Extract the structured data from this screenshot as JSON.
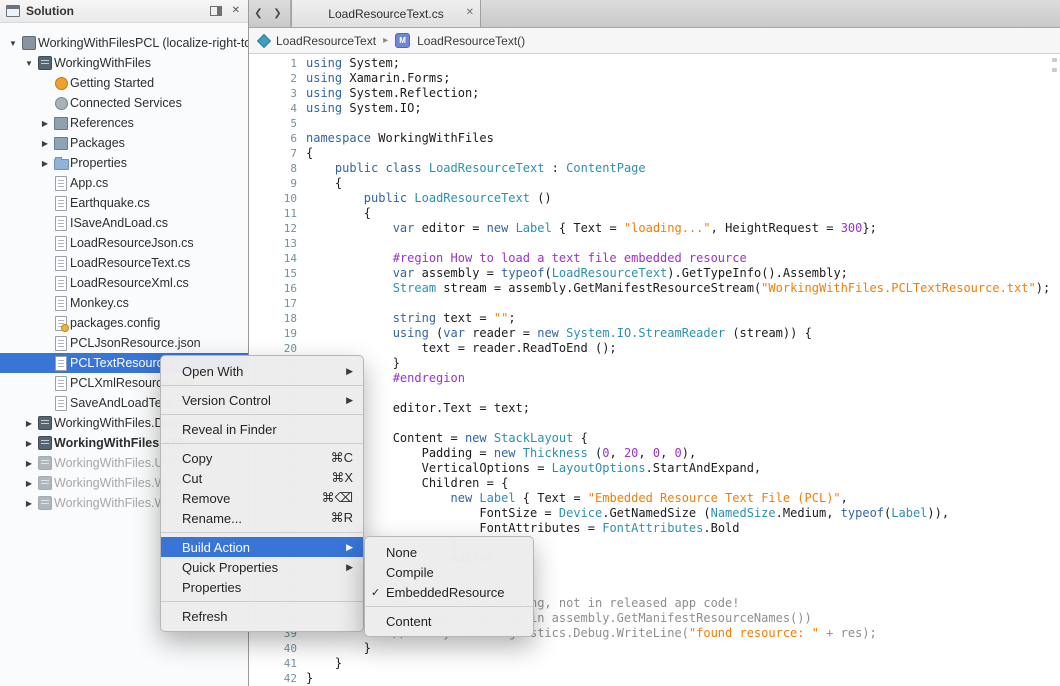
{
  "colors": {
    "selection_blue": "#3875d6",
    "keyword_blue": "#3364a4",
    "type_teal": "#2b91af",
    "string_orange": "#f57d00",
    "number_purple": "#9933cc",
    "comment_gray": "#8e8e8e"
  },
  "sidebar": {
    "title": "Solution",
    "items": [
      {
        "label": "WorkingWithFilesPCL (localize-right-to-lef",
        "level": 0,
        "expander": "open",
        "icon": "solution"
      },
      {
        "label": "WorkingWithFiles",
        "level": 1,
        "expander": "open",
        "icon": "project"
      },
      {
        "label": "Getting Started",
        "level": 2,
        "icon": "getting-started"
      },
      {
        "label": "Connected Services",
        "level": 2,
        "icon": "connected-services"
      },
      {
        "label": "References",
        "level": 2,
        "expander": "closed",
        "icon": "references"
      },
      {
        "label": "Packages",
        "level": 2,
        "expander": "closed",
        "icon": "packages"
      },
      {
        "label": "Properties",
        "level": 2,
        "expander": "closed",
        "icon": "folder"
      },
      {
        "label": "App.cs",
        "level": 2,
        "icon": "doc"
      },
      {
        "label": "Earthquake.cs",
        "level": 2,
        "icon": "doc"
      },
      {
        "label": "ISaveAndLoad.cs",
        "level": 2,
        "icon": "doc"
      },
      {
        "label": "LoadResourceJson.cs",
        "level": 2,
        "icon": "doc"
      },
      {
        "label": "LoadResourceText.cs",
        "level": 2,
        "icon": "doc"
      },
      {
        "label": "LoadResourceXml.cs",
        "level": 2,
        "icon": "doc"
      },
      {
        "label": "Monkey.cs",
        "level": 2,
        "icon": "doc"
      },
      {
        "label": "packages.config",
        "level": 2,
        "icon": "doc-config"
      },
      {
        "label": "PCLJsonResource.json",
        "level": 2,
        "icon": "doc"
      },
      {
        "label": "PCLTextResource.txt",
        "level": 2,
        "icon": "doc",
        "selected": true
      },
      {
        "label": "PCLXmlResource.xml",
        "level": 2,
        "icon": "doc"
      },
      {
        "label": "SaveAndLoadText.cs",
        "level": 2,
        "icon": "doc"
      },
      {
        "label": "WorkingWithFiles.Droid",
        "level": 1,
        "expander": "closed",
        "icon": "project"
      },
      {
        "label": "WorkingWithFiles.iOS",
        "level": 1,
        "expander": "closed",
        "icon": "project",
        "bold": true
      },
      {
        "label": "WorkingWithFiles.UWP",
        "level": 1,
        "expander": "closed",
        "icon": "project",
        "dim": true
      },
      {
        "label": "WorkingWithFiles.WinP",
        "level": 1,
        "expander": "closed",
        "icon": "project",
        "dim": true
      },
      {
        "label": "WorkingWithFiles.WinP",
        "level": 1,
        "expander": "closed",
        "icon": "project",
        "dim": true
      }
    ]
  },
  "tabbar": {
    "back_icon": "❮",
    "forward_icon": "❯",
    "tab_label": "LoadResourceText.cs",
    "close_icon": "✕"
  },
  "breadcrumb": {
    "class_name": "LoadResourceText",
    "chevron": "▸",
    "method_icon_letter": "M",
    "method_name": "LoadResourceText()"
  },
  "editor": {
    "lines": [
      [
        [
          "kw",
          "using"
        ],
        [
          "pl",
          " System;"
        ]
      ],
      [
        [
          "kw",
          "using"
        ],
        [
          "pl",
          " Xamarin.Forms;"
        ]
      ],
      [
        [
          "kw",
          "using"
        ],
        [
          "pl",
          " System.Reflection;"
        ]
      ],
      [
        [
          "kw",
          "using"
        ],
        [
          "pl",
          " System.IO;"
        ]
      ],
      [],
      [
        [
          "kw",
          "namespace"
        ],
        [
          "pl",
          " WorkingWithFiles"
        ]
      ],
      [
        [
          "pl",
          "{"
        ]
      ],
      [
        [
          "pl",
          "    "
        ],
        [
          "kw",
          "public"
        ],
        [
          "pl",
          " "
        ],
        [
          "kw",
          "class"
        ],
        [
          "pl",
          " "
        ],
        [
          "ty",
          "LoadResourceText"
        ],
        [
          "pl",
          " : "
        ],
        [
          "ty",
          "ContentPage"
        ]
      ],
      [
        [
          "pl",
          "    {"
        ]
      ],
      [
        [
          "pl",
          "        "
        ],
        [
          "kw",
          "public"
        ],
        [
          "pl",
          " "
        ],
        [
          "ty",
          "LoadResourceText"
        ],
        [
          "pl",
          " ()"
        ]
      ],
      [
        [
          "pl",
          "        {"
        ]
      ],
      [
        [
          "pl",
          "            "
        ],
        [
          "kw",
          "var"
        ],
        [
          "pl",
          " editor = "
        ],
        [
          "kw",
          "new"
        ],
        [
          "pl",
          " "
        ],
        [
          "ty",
          "Label"
        ],
        [
          "pl",
          " { Text = "
        ],
        [
          "st",
          "\"loading...\""
        ],
        [
          "pl",
          ", HeightRequest = "
        ],
        [
          "nu",
          "300"
        ],
        [
          "pl",
          "};"
        ]
      ],
      [],
      [
        [
          "pp",
          "            #region How to load a text file embedded resource"
        ]
      ],
      [
        [
          "pl",
          "            "
        ],
        [
          "kw",
          "var"
        ],
        [
          "pl",
          " assembly = "
        ],
        [
          "kw",
          "typeof"
        ],
        [
          "pl",
          "("
        ],
        [
          "ty",
          "LoadResourceText"
        ],
        [
          "pl",
          ").GetTypeInfo().Assembly;"
        ]
      ],
      [
        [
          "pl",
          "            "
        ],
        [
          "ty",
          "Stream"
        ],
        [
          "pl",
          " stream = assembly.GetManifestResourceStream("
        ],
        [
          "st",
          "\"WorkingWithFiles.PCLTextResource.txt\""
        ],
        [
          "pl",
          ");"
        ]
      ],
      [],
      [
        [
          "pl",
          "            "
        ],
        [
          "kw",
          "string"
        ],
        [
          "pl",
          " text = "
        ],
        [
          "st",
          "\"\""
        ],
        [
          "pl",
          ";"
        ]
      ],
      [
        [
          "pl",
          "            "
        ],
        [
          "kw",
          "using"
        ],
        [
          "pl",
          " ("
        ],
        [
          "kw",
          "var"
        ],
        [
          "pl",
          " reader = "
        ],
        [
          "kw",
          "new"
        ],
        [
          "pl",
          " "
        ],
        [
          "ty",
          "System.IO.StreamReader"
        ],
        [
          "pl",
          " (stream)) {"
        ]
      ],
      [
        [
          "pl",
          "                text = reader.ReadToEnd ();"
        ]
      ],
      [
        [
          "pl",
          "            }"
        ]
      ],
      [
        [
          "pp",
          "            #endregion"
        ]
      ],
      [],
      [
        [
          "pl",
          "            editor.Text = text;"
        ]
      ],
      [],
      [
        [
          "pl",
          "            Content = "
        ],
        [
          "kw",
          "new"
        ],
        [
          "pl",
          " "
        ],
        [
          "ty",
          "StackLayout"
        ],
        [
          "pl",
          " {"
        ]
      ],
      [
        [
          "pl",
          "                Padding = "
        ],
        [
          "kw",
          "new"
        ],
        [
          "pl",
          " "
        ],
        [
          "ty",
          "Thickness"
        ],
        [
          "pl",
          " ("
        ],
        [
          "nu",
          "0"
        ],
        [
          "pl",
          ", "
        ],
        [
          "nu",
          "20"
        ],
        [
          "pl",
          ", "
        ],
        [
          "nu",
          "0"
        ],
        [
          "pl",
          ", "
        ],
        [
          "nu",
          "0"
        ],
        [
          "pl",
          "),"
        ]
      ],
      [
        [
          "pl",
          "                VerticalOptions = "
        ],
        [
          "ty",
          "LayoutOptions"
        ],
        [
          "pl",
          ".StartAndExpand,"
        ]
      ],
      [
        [
          "pl",
          "                Children = {"
        ]
      ],
      [
        [
          "pl",
          "                    "
        ],
        [
          "kw",
          "new"
        ],
        [
          "pl",
          " "
        ],
        [
          "ty",
          "Label"
        ],
        [
          "pl",
          " { Text = "
        ],
        [
          "st",
          "\"Embedded Resource Text File (PCL)\""
        ],
        [
          "pl",
          ","
        ]
      ],
      [
        [
          "pl",
          "                        FontSize = "
        ],
        [
          "ty",
          "Device"
        ],
        [
          "pl",
          ".GetNamedSize ("
        ],
        [
          "ty",
          "NamedSize"
        ],
        [
          "pl",
          ".Medium, "
        ],
        [
          "kw",
          "typeof"
        ],
        [
          "pl",
          "("
        ],
        [
          "ty",
          "Label"
        ],
        [
          "pl",
          ")),"
        ]
      ],
      [
        [
          "pl",
          "                        FontAttributes = "
        ],
        [
          "ty",
          "FontAttributes"
        ],
        [
          "pl",
          ".Bold"
        ]
      ],
      [
        [
          "pl",
          "                    },"
        ]
      ],
      [
        [
          "pl",
          "                    editor"
        ]
      ],
      [
        [
          "pl",
          "                }"
        ]
      ],
      [
        [
          "pl",
          "            };"
        ]
      ],
      [
        [
          "cm",
          "            // just for debugging, not in released app code!"
        ]
      ],
      [
        [
          "cm",
          "            //foreach (var res in assembly.GetManifestResourceNames())"
        ]
      ],
      [
        [
          "cm",
          "            //    System.Diagnostics.Debug.WriteLine("
        ],
        [
          "st",
          "\"found resource: \""
        ],
        [
          "cm",
          " + res);"
        ]
      ],
      [
        [
          "pl",
          "        }"
        ]
      ],
      [
        [
          "pl",
          "    }"
        ]
      ],
      [
        [
          "pl",
          "}"
        ]
      ]
    ]
  },
  "context_menu": {
    "items": [
      {
        "label": "Open With",
        "submenu": true
      },
      {
        "type": "sep"
      },
      {
        "label": "Version Control",
        "submenu": true
      },
      {
        "type": "sep"
      },
      {
        "label": "Reveal in Finder"
      },
      {
        "type": "sep"
      },
      {
        "label": "Copy",
        "shortcut": "⌘C"
      },
      {
        "label": "Cut",
        "shortcut": "⌘X"
      },
      {
        "label": "Remove",
        "shortcut": "⌘⌫"
      },
      {
        "label": "Rename...",
        "shortcut": "⌘R"
      },
      {
        "type": "sep"
      },
      {
        "label": "Build Action",
        "submenu": true,
        "highlighted": true
      },
      {
        "label": "Quick Properties",
        "submenu": true
      },
      {
        "label": "Properties"
      },
      {
        "type": "sep"
      },
      {
        "label": "Refresh"
      }
    ]
  },
  "build_action_submenu": {
    "items": [
      {
        "label": "None"
      },
      {
        "label": "Compile"
      },
      {
        "label": "EmbeddedResource",
        "checked": true
      },
      {
        "type": "sep"
      },
      {
        "label": "Content"
      }
    ]
  }
}
